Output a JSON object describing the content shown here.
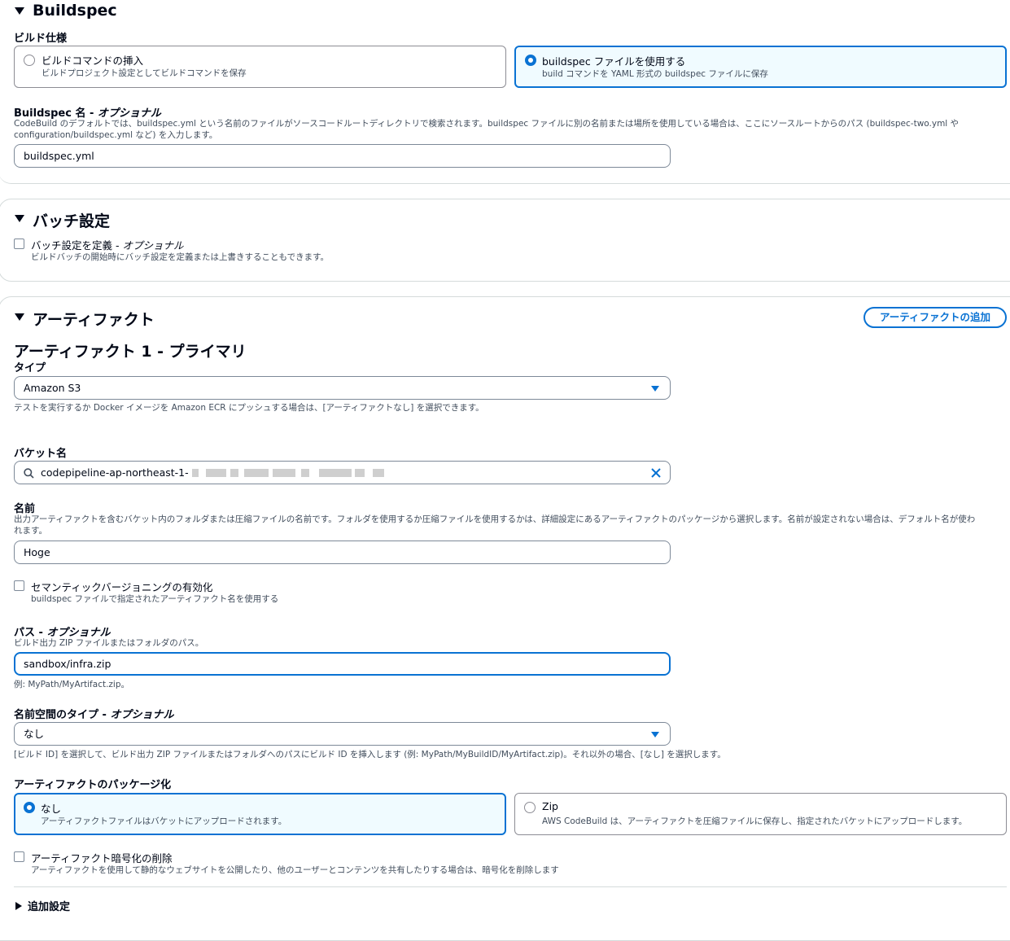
{
  "buildspec": {
    "title": "Buildspec",
    "spec_label": "ビルド仕様",
    "option_insert_title": "ビルドコマンドの挿入",
    "option_insert_desc": "ビルドプロジェクト設定としてビルドコマンドを保存",
    "option_file_title": "buildspec ファイルを使用する",
    "option_file_desc": "build コマンドを YAML 形式の buildspec ファイルに保存",
    "name_label_main": "Buildspec 名 - ",
    "name_label_opt": "オプショナル",
    "name_desc_1": "CodeBuild のデフォルトでは、buildspec.yml という名前のファイルがソースコードルートディレクトリで検索されます。buildspec ファイルに別の名前または場所を使用している場合は、ここにソースルートからのパス (buildspec-two.yml や",
    "name_desc_2": "configuration/buildspec.yml など) を入力します。",
    "name_value": "buildspec.yml"
  },
  "batch": {
    "title": "バッチ設定",
    "define_label_main": "バッチ設定を定義 - ",
    "define_label_opt": "オプショナル",
    "define_desc": "ビルドバッチの開始時にバッチ設定を定義または上書きすることもできます。"
  },
  "artifacts": {
    "title": "アーティファクト",
    "add_button": "アーティファクトの追加",
    "primary_heading": "アーティファクト 1 - プライマリ",
    "type_label": "タイプ",
    "type_value": "Amazon S3",
    "type_desc": "テストを実行するか Docker イメージを Amazon ECR にプッシュする場合は、[アーティファクトなし] を選択できます。",
    "bucket_label": "バケット名",
    "bucket_value": "codepipeline-ap-northeast-1-",
    "name_label": "名前",
    "name_desc_1": "出力アーティファクトを含むバケット内のフォルダまたは圧縮ファイルの名前です。フォルダを使用するか圧縮ファイルを使用するかは、詳細設定にあるアーティファクトのパッケージから選択します。名前が設定されない場合は、デフォルト名が使わ",
    "name_desc_2": "れます。",
    "name_value": "Hoge",
    "semver_label": "セマンティックバージョニングの有効化",
    "semver_desc": "buildspec ファイルで指定されたアーティファクト名を使用する",
    "path_label_main": "パス - ",
    "path_label_opt": "オプショナル",
    "path_desc": "ビルド出力 ZIP ファイルまたはフォルダのパス。",
    "path_value": "sandbox/infra.zip",
    "path_example": "例: MyPath/MyArtifact.zip。",
    "ns_label_main": "名前空間のタイプ - ",
    "ns_label_opt": "オプショナル",
    "ns_value": "なし",
    "ns_desc": "[ビルド ID] を選択して、ビルド出力 ZIP ファイルまたはフォルダへのパスにビルド ID を挿入します (例: MyPath/MyBuildID/MyArtifact.zip)。それ以外の場合、[なし] を選択します。",
    "packaging_label": "アーティファクトのパッケージ化",
    "pkg_none_title": "なし",
    "pkg_none_desc": "アーティファクトファイルはバケットにアップロードされます。",
    "pkg_zip_title": "Zip",
    "pkg_zip_desc": "AWS CodeBuild は、アーティファクトを圧縮ファイルに保存し、指定されたバケットにアップロードします。",
    "encrypt_label": "アーティファクト暗号化の削除",
    "encrypt_desc": "アーティファクトを使用して静的なウェブサイトを公開したり、他のユーザーとコンテンツを共有したりする場合は、暗号化を削除します",
    "additional_settings": "追加設定"
  },
  "colors": {
    "accent": "#0972d3",
    "selected_bg": "#f0fbff",
    "text": "#000716",
    "muted": "#414d5c"
  }
}
